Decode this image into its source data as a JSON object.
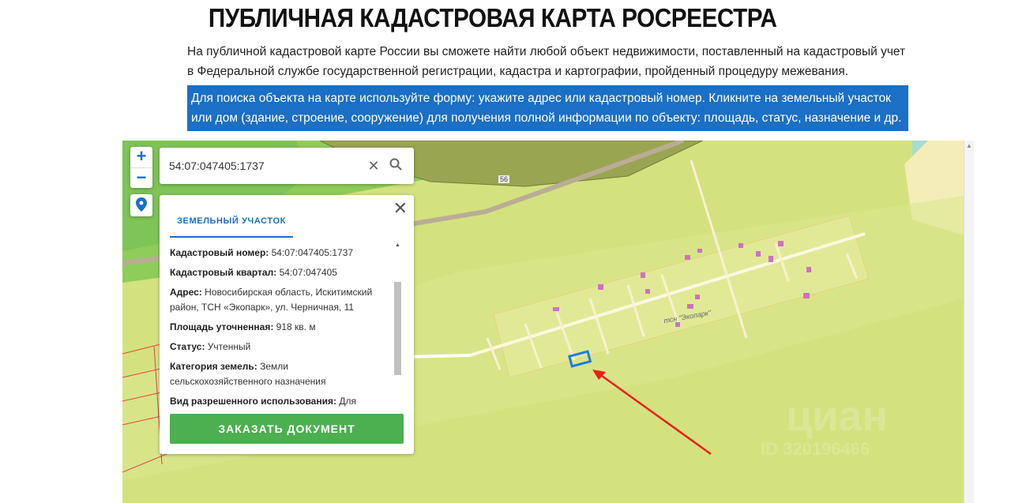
{
  "page": {
    "title": "ПУБЛИЧНАЯ КАДАСТРОВАЯ КАРТА РОСРЕЕСТРА",
    "intro": "На публичной кадастровой карте России вы сможете найти любой объект недвижимости, поставленный на кадастровый учет в Федеральной службе государственной регистрации, кадастра и картографии, пройденный процедуру межевания.",
    "hint": "Для поиска объекта на карте используйте форму: укажите адрес или кадастровый номер. Кликните на земельный участок или дом (здание, строение, сооружение) для получения полной информации по объекту: площадь, статус, назначение и др."
  },
  "map": {
    "zoom_in": "+",
    "zoom_out": "−",
    "search_value": "54:07:047405:1737",
    "road_label": "56",
    "settlement_label": "тсн \"Экопарк\"",
    "watermark": "циан",
    "watermark_id": "ID 320196466",
    "colors": {
      "selected": "#1e7be6",
      "arrow": "#ee1c1c",
      "button": "#4caf50",
      "accent": "#1b6fc4"
    }
  },
  "panel": {
    "tab": "ЗЕМЕЛЬНЫЙ УЧАСТОК",
    "fields": [
      {
        "label": "Кадастровый номер:",
        "value": "54:07:047405:1737"
      },
      {
        "label": "Кадастровый квартал:",
        "value": "54:07:047405"
      },
      {
        "label": "Адрес:",
        "value": "Новосибирская область, Искитимский район, ТСН «Экопарк», ул. Черничная, 11"
      },
      {
        "label": "Площадь уточненная:",
        "value": "918 кв. м"
      },
      {
        "label": "Статус:",
        "value": "Учтенный"
      },
      {
        "label": "Категория земель:",
        "value": "Земли сельскохозяйственного назначения"
      },
      {
        "label": "Вид разрешенного использования:",
        "value": "Для ведения"
      }
    ],
    "order_button": "ЗАКАЗАТЬ ДОКУМЕНТ"
  }
}
